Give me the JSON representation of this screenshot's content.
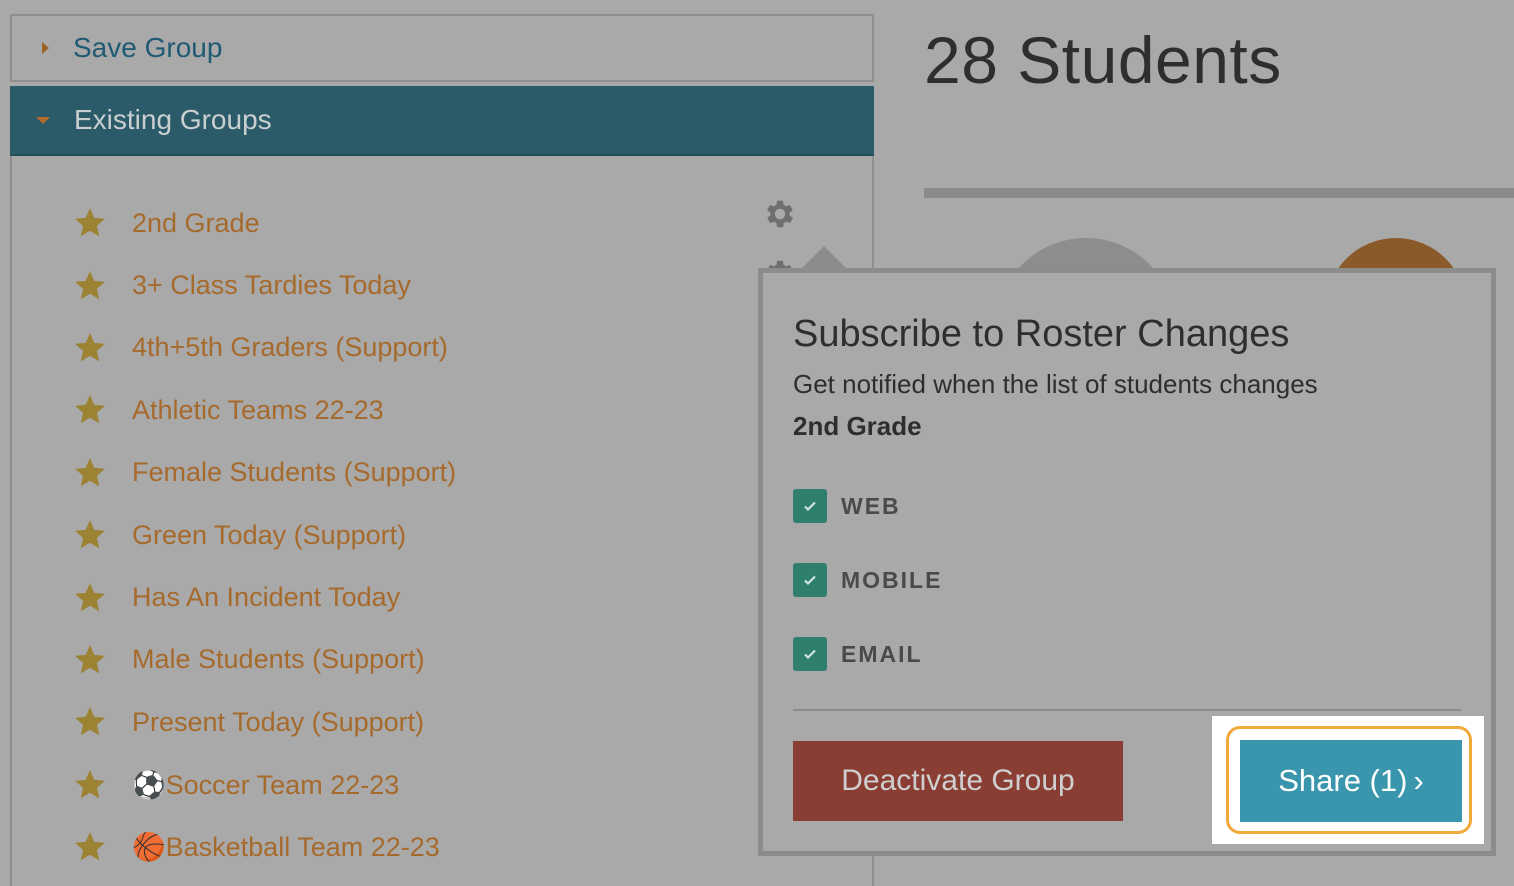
{
  "sidebar": {
    "save_group_label": "Save Group",
    "existing_groups_label": "Existing Groups",
    "groups": [
      {
        "label": "2nd Grade"
      },
      {
        "label": "3+ Class Tardies Today"
      },
      {
        "label": "4th+5th Graders (Support)"
      },
      {
        "label": "Athletic Teams 22-23"
      },
      {
        "label": "Female Students (Support)"
      },
      {
        "label": "Green Today (Support)"
      },
      {
        "label": "Has An Incident Today"
      },
      {
        "label": "Male Students (Support)"
      },
      {
        "label": "Present Today (Support)"
      },
      {
        "label": "⚽Soccer Team 22-23"
      },
      {
        "label": "🏀Basketball Team 22-23"
      }
    ]
  },
  "main": {
    "title": "28 Students"
  },
  "popover": {
    "title": "Subscribe to Roster Changes",
    "subtitle": "Get notified when the list of students changes",
    "group_name": "2nd Grade",
    "options": [
      {
        "label": "WEB",
        "checked": true
      },
      {
        "label": "MOBILE",
        "checked": true
      },
      {
        "label": "EMAIL",
        "checked": true
      }
    ],
    "deactivate_label": "Deactivate Group",
    "share_label": "Share (1)",
    "share_chevron": "›"
  },
  "colors": {
    "header_bg": "#2b5a69",
    "group_text": "#a66a2c",
    "checkbox": "#2f7f6f",
    "deactivate_bg": "#8a3d33",
    "share_bg": "#3a96ad",
    "highlight_ring": "#f1a93a"
  },
  "icons": {
    "star": "star-icon",
    "gear": "gear-icon",
    "check": "check-icon",
    "caret_right": "caret-right-icon",
    "caret_down": "caret-down-icon"
  }
}
